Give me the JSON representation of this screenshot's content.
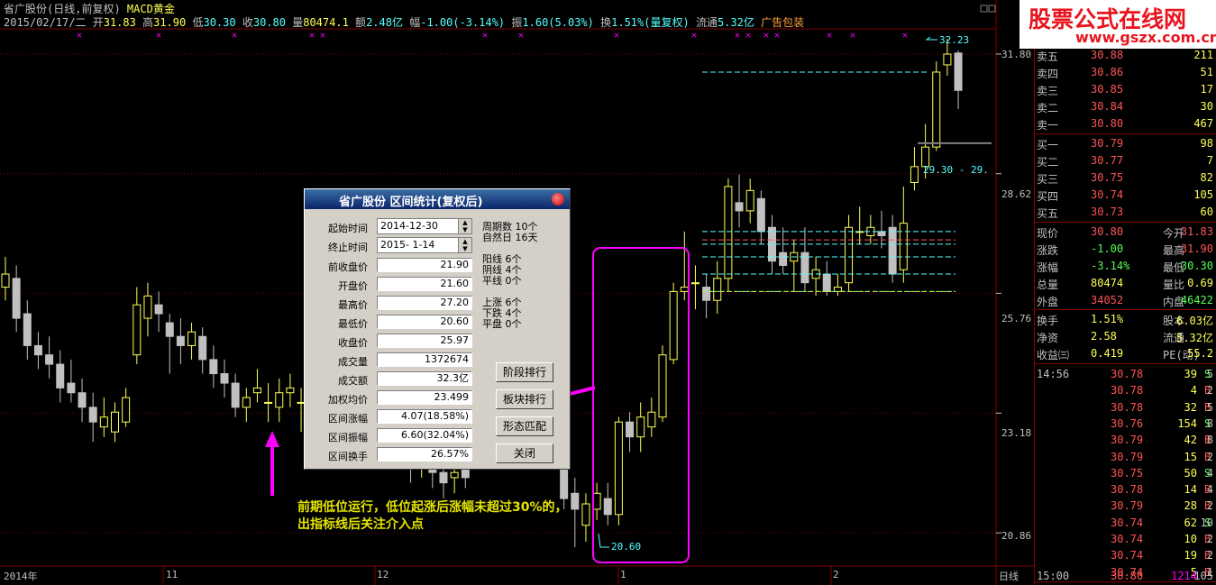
{
  "header": {
    "title_line": "省广股份(日线,前复权)",
    "indicator_name": "MACD黄金",
    "date": "2015/02/17/二",
    "open_label": "开",
    "open": "31.83",
    "high_label": "高",
    "high": "31.90",
    "low_label": "低",
    "low": "30.30",
    "close_label": "收",
    "close": "30.80",
    "volume_label": "量",
    "volume": "80474.1",
    "amount_label": "额",
    "amount": "2.48亿",
    "change_label": "幅",
    "change": "-1.00(-3.14%)",
    "amplitude_label": "振",
    "amplitude": "1.60(5.03%)",
    "turnover_label": "换",
    "turnover": "1.51%(量复权)",
    "float_label": "流通",
    "float": "5.32亿",
    "ad": "广告包装"
  },
  "logo": {
    "text": "股票公式在线网",
    "url": "www.gszx.com.cn"
  },
  "y_axis": {
    "labels": [
      "31.80",
      "28.62",
      "25.76",
      "23.18",
      "20.86"
    ]
  },
  "x_axis": {
    "labels": [
      "2014年",
      "11",
      "12",
      "1",
      "2"
    ],
    "period": "日线"
  },
  "chart_annotations": {
    "high_mark": "32.23",
    "low_mark": "20.60",
    "range_label": "29.30 - 29."
  },
  "colors": {
    "up": "#ffff54",
    "down": "#c0c0c0",
    "highlight": "#ff00ff",
    "grid": "#800000",
    "level_line": "#54ffff"
  },
  "note": "前期低位运行，低位起涨后涨幅未超过30%的，出指标线后关注介入点",
  "dialog": {
    "title": "省广股份 区间统计(复权后)",
    "start_label": "起始时间",
    "start_value": "2014-12-30",
    "end_label": "终止时间",
    "end_value": "2015- 1-14",
    "period_count": "周期数 10个",
    "natural_days": "自然日 16天",
    "fields": [
      {
        "label": "前收盘价",
        "value": "21.90"
      },
      {
        "label": "开盘价",
        "value": "21.60"
      },
      {
        "label": "最高价",
        "value": "27.20"
      },
      {
        "label": "最低价",
        "value": "20.60"
      },
      {
        "label": "收盘价",
        "value": "25.97"
      },
      {
        "label": "成交量",
        "value": "1372674"
      },
      {
        "label": "成交额",
        "value": "32.3亿"
      },
      {
        "label": "加权均价",
        "value": "23.499"
      },
      {
        "label": "区间涨幅",
        "value": "4.07(18.58%)"
      },
      {
        "label": "区间振幅",
        "value": "6.60(32.04%)"
      },
      {
        "label": "区间换手",
        "value": "26.57%"
      }
    ],
    "yang": "阳线 6个",
    "yin": "阴线 4个",
    "flat": "平线 0个",
    "rise": "上涨 6个",
    "fall": "下跌 4个",
    "even": "平盘 0个",
    "buttons": {
      "rank": "阶段排行",
      "sector": "板块排行",
      "pattern": "形态匹配",
      "close": "关闭"
    }
  },
  "orderbook": {
    "sell": [
      {
        "label": "卖五",
        "price": "30.88",
        "vol": "211"
      },
      {
        "label": "卖四",
        "price": "30.86",
        "vol": "51"
      },
      {
        "label": "卖三",
        "price": "30.85",
        "vol": "17"
      },
      {
        "label": "卖二",
        "price": "30.84",
        "vol": "30"
      },
      {
        "label": "卖一",
        "price": "30.80",
        "vol": "467"
      }
    ],
    "buy": [
      {
        "label": "买一",
        "price": "30.79",
        "vol": "98"
      },
      {
        "label": "买二",
        "price": "30.77",
        "vol": "7"
      },
      {
        "label": "买三",
        "price": "30.75",
        "vol": "82"
      },
      {
        "label": "买四",
        "price": "30.74",
        "vol": "105"
      },
      {
        "label": "买五",
        "price": "30.73",
        "vol": "60"
      }
    ]
  },
  "quote": [
    {
      "l1": "现价",
      "v1": "30.80",
      "l2": "今开",
      "v2": "31.83",
      "c1": "#ff5454",
      "c2": "#ff5454"
    },
    {
      "l1": "涨跌",
      "v1": "-1.00",
      "l2": "最高",
      "v2": "31.90",
      "c1": "#54ff54",
      "c2": "#ff5454"
    },
    {
      "l1": "涨幅",
      "v1": "-3.14%",
      "l2": "最低",
      "v2": "30.30",
      "c1": "#54ff54",
      "c2": "#54ff54"
    },
    {
      "l1": "总量",
      "v1": "80474",
      "l2": "量比",
      "v2": "0.69",
      "c1": "#ffff54",
      "c2": "#ffff54"
    },
    {
      "l1": "外盘",
      "v1": "34052",
      "l2": "内盘",
      "v2": "46422",
      "c1": "#ff5454",
      "c2": "#54ff54"
    },
    {
      "l1": "换手",
      "v1": "1.51%",
      "l2": "股本",
      "v2": "6.03亿",
      "c1": "#ffff54",
      "c2": "#ffff54"
    },
    {
      "l1": "净资",
      "v1": "2.58",
      "l2": "流通",
      "v2": "5.32亿",
      "c1": "#ffff54",
      "c2": "#ffff54"
    },
    {
      "l1": "收益㈢",
      "v1": "0.419",
      "l2": "PE(动)",
      "v2": "55.2",
      "c1": "#ffff54",
      "c2": "#ffff54"
    }
  ],
  "ticks": [
    {
      "t": "14:56",
      "p": "30.78",
      "v": "39",
      "bs": "S",
      "n": "5"
    },
    {
      "t": "",
      "p": "30.78",
      "v": "4",
      "bs": "B",
      "n": "2"
    },
    {
      "t": "",
      "p": "30.78",
      "v": "32",
      "bs": "B",
      "n": "5"
    },
    {
      "t": "",
      "p": "30.76",
      "v": "154",
      "bs": "S",
      "n": "8"
    },
    {
      "t": "",
      "p": "30.79",
      "v": "42",
      "bs": "B",
      "n": "8"
    },
    {
      "t": "",
      "p": "30.79",
      "v": "15",
      "bs": "B",
      "n": "2"
    },
    {
      "t": "",
      "p": "30.75",
      "v": "50",
      "bs": "S",
      "n": "4"
    },
    {
      "t": "",
      "p": "30.78",
      "v": "14",
      "bs": "B",
      "n": "4"
    },
    {
      "t": "",
      "p": "30.79",
      "v": "28",
      "bs": "B",
      "n": "2"
    },
    {
      "t": "",
      "p": "30.74",
      "v": "62",
      "bs": "S",
      "n": "10"
    },
    {
      "t": "",
      "p": "30.74",
      "v": "10",
      "bs": "B",
      "n": "2"
    },
    {
      "t": "",
      "p": "30.74",
      "v": "19",
      "bs": "B",
      "n": "2"
    },
    {
      "t": "",
      "p": "30.74",
      "v": "5",
      "bs": "B",
      "n": "1"
    },
    {
      "t": "15:00",
      "p": "30.80",
      "v": "1214",
      "bs": "",
      "n": "105"
    }
  ],
  "candles": [
    {
      "o": 25.9,
      "c": 26.2,
      "h": 26.6,
      "l": 25.6
    },
    {
      "o": 26.1,
      "c": 25.2,
      "h": 26.4,
      "l": 24.9
    },
    {
      "o": 25.3,
      "c": 24.6,
      "h": 25.6,
      "l": 24.3
    },
    {
      "o": 24.6,
      "c": 24.4,
      "h": 24.9,
      "l": 24.1
    },
    {
      "o": 24.4,
      "c": 24.2,
      "h": 24.8,
      "l": 23.9
    },
    {
      "o": 24.2,
      "c": 23.7,
      "h": 24.5,
      "l": 23.4
    },
    {
      "o": 23.8,
      "c": 23.6,
      "h": 24.3,
      "l": 23.4
    },
    {
      "o": 23.6,
      "c": 23.3,
      "h": 23.9,
      "l": 23.0
    },
    {
      "o": 23.3,
      "c": 23.0,
      "h": 23.6,
      "l": 22.6
    },
    {
      "o": 22.9,
      "c": 23.1,
      "h": 23.5,
      "l": 22.7
    },
    {
      "o": 22.8,
      "c": 23.2,
      "h": 23.4,
      "l": 22.6
    },
    {
      "o": 23.0,
      "c": 23.5,
      "h": 23.7,
      "l": 22.9
    },
    {
      "o": 24.4,
      "c": 25.5,
      "h": 25.9,
      "l": 24.2
    },
    {
      "o": 25.2,
      "c": 25.7,
      "h": 26.0,
      "l": 24.8
    },
    {
      "o": 25.5,
      "c": 25.3,
      "h": 25.8,
      "l": 24.9
    },
    {
      "o": 25.1,
      "c": 24.8,
      "h": 25.3,
      "l": 24.0
    },
    {
      "o": 24.8,
      "c": 24.6,
      "h": 25.2,
      "l": 24.2
    },
    {
      "o": 24.6,
      "c": 24.9,
      "h": 25.1,
      "l": 24.3
    },
    {
      "o": 24.8,
      "c": 24.3,
      "h": 25.0,
      "l": 24.0
    },
    {
      "o": 24.3,
      "c": 24.0,
      "h": 24.6,
      "l": 23.7
    },
    {
      "o": 24.0,
      "c": 23.8,
      "h": 24.3,
      "l": 23.5
    },
    {
      "o": 23.8,
      "c": 23.3,
      "h": 24.0,
      "l": 23.1
    },
    {
      "o": 23.3,
      "c": 23.5,
      "h": 23.7,
      "l": 23.0
    },
    {
      "o": 23.6,
      "c": 23.7,
      "h": 24.1,
      "l": 23.4
    },
    {
      "o": 23.4,
      "c": 23.4,
      "h": 23.8,
      "l": 23.0
    },
    {
      "o": 23.3,
      "c": 23.6,
      "h": 23.9,
      "l": 23.0
    },
    {
      "o": 23.6,
      "c": 23.7,
      "h": 24.0,
      "l": 23.3
    },
    {
      "o": 23.4,
      "c": 23.4,
      "h": 23.7,
      "l": 22.8
    },
    {
      "o": 23.2,
      "c": 22.8,
      "h": 23.4,
      "l": 22.5
    },
    {
      "o": 23.1,
      "c": 23.3,
      "h": 23.5,
      "l": 22.8
    },
    {
      "o": 23.0,
      "c": 23.2,
      "h": 23.4,
      "l": 22.8
    },
    {
      "o": 23.4,
      "c": 23.9,
      "h": 24.2,
      "l": 23.3
    },
    {
      "o": 23.8,
      "c": 23.4,
      "h": 24.0,
      "l": 23.2
    },
    {
      "o": 23.6,
      "c": 23.9,
      "h": 24.1,
      "l": 23.4
    },
    {
      "o": 23.9,
      "c": 23.6,
      "h": 24.1,
      "l": 23.3
    },
    {
      "o": 23.4,
      "c": 22.9,
      "h": 23.6,
      "l": 22.6
    },
    {
      "o": 22.9,
      "c": 22.5,
      "h": 23.1,
      "l": 22.2
    },
    {
      "o": 22.5,
      "c": 22.1,
      "h": 22.7,
      "l": 21.8
    },
    {
      "o": 22.2,
      "c": 22.4,
      "h": 22.8,
      "l": 21.9
    },
    {
      "o": 22.4,
      "c": 22.0,
      "h": 22.6,
      "l": 21.7
    },
    {
      "o": 22.0,
      "c": 21.8,
      "h": 22.3,
      "l": 21.5
    },
    {
      "o": 21.9,
      "c": 22.0,
      "h": 22.3,
      "l": 21.6
    },
    {
      "o": 22.3,
      "c": 21.9,
      "h": 22.6,
      "l": 21.7
    },
    {
      "o": 23.0,
      "c": 22.4,
      "h": 23.2,
      "l": 22.1
    },
    {
      "o": 23.1,
      "c": 22.6,
      "h": 23.3,
      "l": 22.3
    },
    {
      "o": 23.4,
      "c": 22.8,
      "h": 23.6,
      "l": 22.5
    },
    {
      "o": 23.2,
      "c": 23.0,
      "h": 23.5,
      "l": 22.7
    },
    {
      "o": 23.5,
      "c": 23.2,
      "h": 23.8,
      "l": 22.9
    },
    {
      "o": 23.0,
      "c": 22.5,
      "h": 23.4,
      "l": 22.3
    },
    {
      "o": 22.9,
      "c": 22.4,
      "h": 23.4,
      "l": 22.1
    },
    {
      "o": 23.6,
      "c": 22.7,
      "h": 23.9,
      "l": 22.4
    },
    {
      "o": 23.0,
      "c": 21.5,
      "h": 23.4,
      "l": 21.3
    },
    {
      "o": 21.6,
      "c": 21.3,
      "h": 21.9,
      "l": 20.6
    },
    {
      "o": 21.0,
      "c": 21.4,
      "h": 21.6,
      "l": 20.7
    },
    {
      "o": 21.3,
      "c": 21.6,
      "h": 21.8,
      "l": 21.1
    },
    {
      "o": 21.5,
      "c": 21.2,
      "h": 21.8,
      "l": 21.0
    },
    {
      "o": 21.2,
      "c": 23.0,
      "h": 23.1,
      "l": 21.0
    },
    {
      "o": 23.0,
      "c": 22.7,
      "h": 23.2,
      "l": 22.4
    },
    {
      "o": 22.7,
      "c": 23.1,
      "h": 23.4,
      "l": 22.4
    },
    {
      "o": 22.9,
      "c": 23.2,
      "h": 23.5,
      "l": 22.7
    },
    {
      "o": 23.1,
      "c": 24.4,
      "h": 24.6,
      "l": 23.0
    },
    {
      "o": 24.3,
      "c": 25.8,
      "h": 26.0,
      "l": 24.2
    },
    {
      "o": 25.8,
      "c": 25.9,
      "h": 27.2,
      "l": 25.6
    },
    {
      "o": 26.0,
      "c": 26.0,
      "h": 26.4,
      "l": 25.4
    },
    {
      "o": 25.9,
      "c": 25.6,
      "h": 26.2,
      "l": 25.2
    },
    {
      "o": 25.6,
      "c": 26.1,
      "h": 26.5,
      "l": 25.3
    },
    {
      "o": 26.1,
      "c": 28.3,
      "h": 28.5,
      "l": 25.8
    },
    {
      "o": 27.9,
      "c": 27.7,
      "h": 28.6,
      "l": 27.3
    },
    {
      "o": 27.7,
      "c": 28.2,
      "h": 28.5,
      "l": 27.4
    },
    {
      "o": 28.0,
      "c": 27.2,
      "h": 28.2,
      "l": 26.9
    },
    {
      "o": 27.3,
      "c": 26.5,
      "h": 27.6,
      "l": 26.2
    },
    {
      "o": 26.7,
      "c": 26.4,
      "h": 27.3,
      "l": 26.2
    },
    {
      "o": 26.5,
      "c": 26.7,
      "h": 27.0,
      "l": 25.8
    },
    {
      "o": 26.7,
      "c": 26.0,
      "h": 27.3,
      "l": 25.8
    },
    {
      "o": 26.1,
      "c": 26.3,
      "h": 26.6,
      "l": 25.7
    },
    {
      "o": 26.2,
      "c": 25.8,
      "h": 26.5,
      "l": 25.7
    },
    {
      "o": 25.8,
      "c": 25.9,
      "h": 26.2,
      "l": 25.7
    },
    {
      "o": 26.0,
      "c": 27.3,
      "h": 27.6,
      "l": 25.8
    },
    {
      "o": 27.2,
      "c": 27.2,
      "h": 27.8,
      "l": 26.9
    },
    {
      "o": 27.1,
      "c": 27.3,
      "h": 27.6,
      "l": 26.9
    },
    {
      "o": 27.2,
      "c": 27.1,
      "h": 27.7,
      "l": 26.8
    },
    {
      "o": 27.3,
      "c": 26.2,
      "h": 27.6,
      "l": 26.0
    },
    {
      "o": 26.3,
      "c": 27.4,
      "h": 28.3,
      "l": 26.0
    },
    {
      "o": 28.4,
      "c": 28.8,
      "h": 29.3,
      "l": 28.2
    },
    {
      "o": 28.8,
      "c": 29.3,
      "h": 29.9,
      "l": 28.5
    },
    {
      "o": 29.3,
      "c": 31.3,
      "h": 31.6,
      "l": 29.2
    },
    {
      "o": 31.5,
      "c": 31.8,
      "h": 32.23,
      "l": 31.2
    },
    {
      "o": 31.83,
      "c": 30.8,
      "h": 31.9,
      "l": 30.3
    }
  ],
  "level_lines": [
    31.3,
    27.2,
    26.9,
    26.6,
    26.2,
    25.8
  ],
  "red_level": 27.0,
  "green_level": 25.8
}
